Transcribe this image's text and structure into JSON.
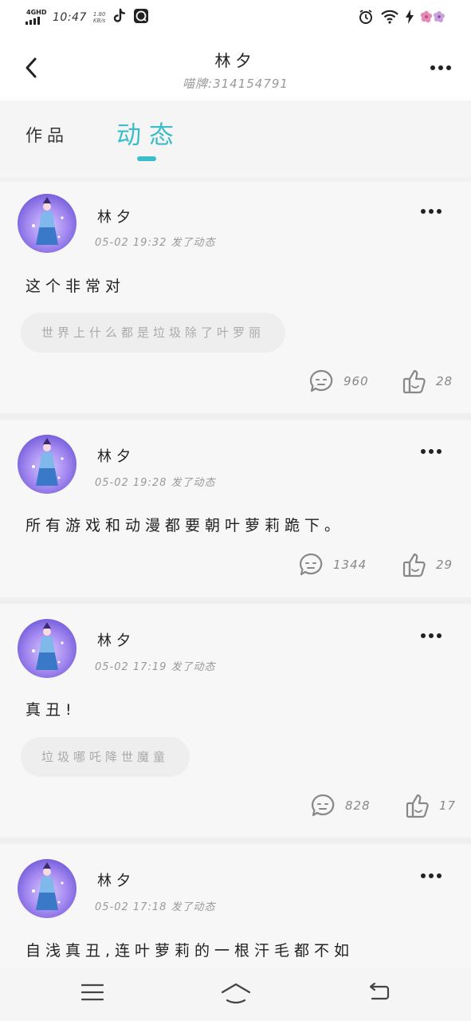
{
  "status_bar": {
    "network": "4GHD",
    "time": "10:47",
    "speed_value": "1.80",
    "speed_unit": "KB/s",
    "icons": [
      "signal-icon",
      "tiktok-icon",
      "qq-music-icon",
      "alarm-icon",
      "wifi-icon",
      "charging-icon",
      "battery-flower-icon"
    ]
  },
  "header": {
    "title": "林夕",
    "subtitle": "喵牌:314154791"
  },
  "tabs": [
    {
      "label": "作品",
      "active": false
    },
    {
      "label": "动态",
      "active": true
    }
  ],
  "colors": {
    "accent": "#3dbcc9",
    "text": "#222222",
    "muted": "#999999",
    "card": "#f7f7f7"
  },
  "posts": [
    {
      "author": "林夕",
      "meta": "05-02 19:32 发了动态",
      "content": "这个非常对",
      "quote": "世界上什么都是垃圾除了叶罗丽",
      "comments": "960",
      "likes": "28"
    },
    {
      "author": "林夕",
      "meta": "05-02 19:28 发了动态",
      "content": "所有游戏和动漫都要朝叶萝莉跪下。",
      "quote": "",
      "comments": "1344",
      "likes": "29"
    },
    {
      "author": "林夕",
      "meta": "05-02 17:19 发了动态",
      "content": "真丑!",
      "quote": "垃圾哪吒降世魔童",
      "comments": "828",
      "likes": "17"
    },
    {
      "author": "林夕",
      "meta": "05-02 17:18 发了动态",
      "content": "自浅真丑,连叶萝莉的一根汗毛都不如",
      "quote": "",
      "comments": "",
      "likes": ""
    }
  ],
  "nav_bar": {
    "icons": [
      "menu-icon",
      "home-icon",
      "back-nav-icon"
    ]
  }
}
